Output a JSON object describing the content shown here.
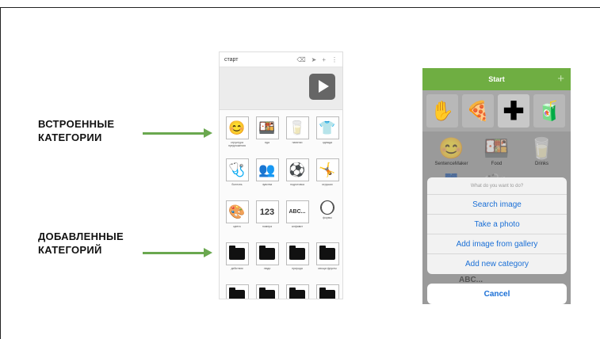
{
  "labels": {
    "builtin_line1": "ВСТРОЕННЫЕ",
    "builtin_line2": "КАТЕГОРИИ",
    "added_line1": "ДОБАВЛЕННЫЕ",
    "added_line2": "КАТЕГОРИЙ"
  },
  "phone1": {
    "title": "старт",
    "toolbar_icons": [
      "backspace-icon",
      "send-icon",
      "add-icon",
      "more-icon"
    ],
    "rows": [
      [
        {
          "icon": "boy-face-icon",
          "glyph": "😊",
          "caption": "структура предложения"
        },
        {
          "icon": "food-icon",
          "glyph": "🍱",
          "caption": "еда"
        },
        {
          "icon": "glass-icon",
          "glyph": "🥛",
          "caption": "напитки"
        },
        {
          "icon": "clothes-icon",
          "glyph": "👕",
          "caption": "одежда"
        }
      ],
      [
        {
          "icon": "doctor-icon",
          "glyph": "🩺",
          "caption": "болезнь"
        },
        {
          "icon": "people-icon",
          "glyph": "👥",
          "caption": "чувства"
        },
        {
          "icon": "ball-icon",
          "glyph": "⚽",
          "caption": "подготовка"
        },
        {
          "icon": "play-icon",
          "glyph": "🤸",
          "caption": "игрушки"
        }
      ],
      [
        {
          "icon": "colors-icon",
          "glyph": "🎨",
          "caption": "цвета"
        },
        {
          "icon": "numbers-icon",
          "glyph": "123",
          "caption": "номера",
          "kind": "txt"
        },
        {
          "icon": "alphabet-icon",
          "glyph": "ABC...",
          "caption": "алфавит",
          "kind": "txt-sm"
        },
        {
          "icon": "shapes-icon",
          "glyph": "",
          "caption": "формы",
          "kind": "circle"
        }
      ],
      [
        {
          "icon": "folder-icon",
          "caption": "действия",
          "kind": "folder"
        },
        {
          "icon": "folder-icon",
          "caption": "люди",
          "kind": "folder"
        },
        {
          "icon": "folder-icon",
          "caption": "природа",
          "kind": "folder"
        },
        {
          "icon": "folder-icon",
          "caption": "овощи фрукты",
          "kind": "folder"
        }
      ],
      [
        {
          "icon": "folder-icon",
          "caption": "",
          "kind": "folder"
        },
        {
          "icon": "folder-icon",
          "caption": "",
          "kind": "folder"
        },
        {
          "icon": "folder-icon",
          "caption": "",
          "kind": "folder"
        },
        {
          "icon": "folder-icon",
          "caption": "",
          "kind": "folder"
        }
      ]
    ]
  },
  "phone2": {
    "title": "Start",
    "strip": [
      {
        "icon": "hand-icon",
        "glyph": "✋"
      },
      {
        "icon": "pizza-icon",
        "glyph": "🍕"
      },
      {
        "icon": "plus-icon",
        "glyph": "✚"
      },
      {
        "icon": "juice-icon",
        "glyph": "🧃"
      }
    ],
    "grid": [
      {
        "icon": "boy-face-icon",
        "glyph": "😊",
        "caption": "SentenceMaker"
      },
      {
        "icon": "food-icon",
        "glyph": "🍱",
        "caption": "Food"
      },
      {
        "icon": "glass-icon",
        "glyph": "🥛",
        "caption": "Drinks"
      },
      {
        "icon": "clothes-icon",
        "glyph": "👖",
        "caption": ""
      },
      {
        "icon": "doctor-icon",
        "glyph": "🩺",
        "caption": ""
      },
      {
        "icon": "people-icon",
        "glyph": "👥",
        "caption": ""
      }
    ],
    "sheet": {
      "question": "What do you want to do?",
      "options": [
        "Search image",
        "Take a photo",
        "Add image from gallery",
        "Add new category"
      ],
      "peek": "ABC...",
      "cancel": "Cancel"
    }
  }
}
